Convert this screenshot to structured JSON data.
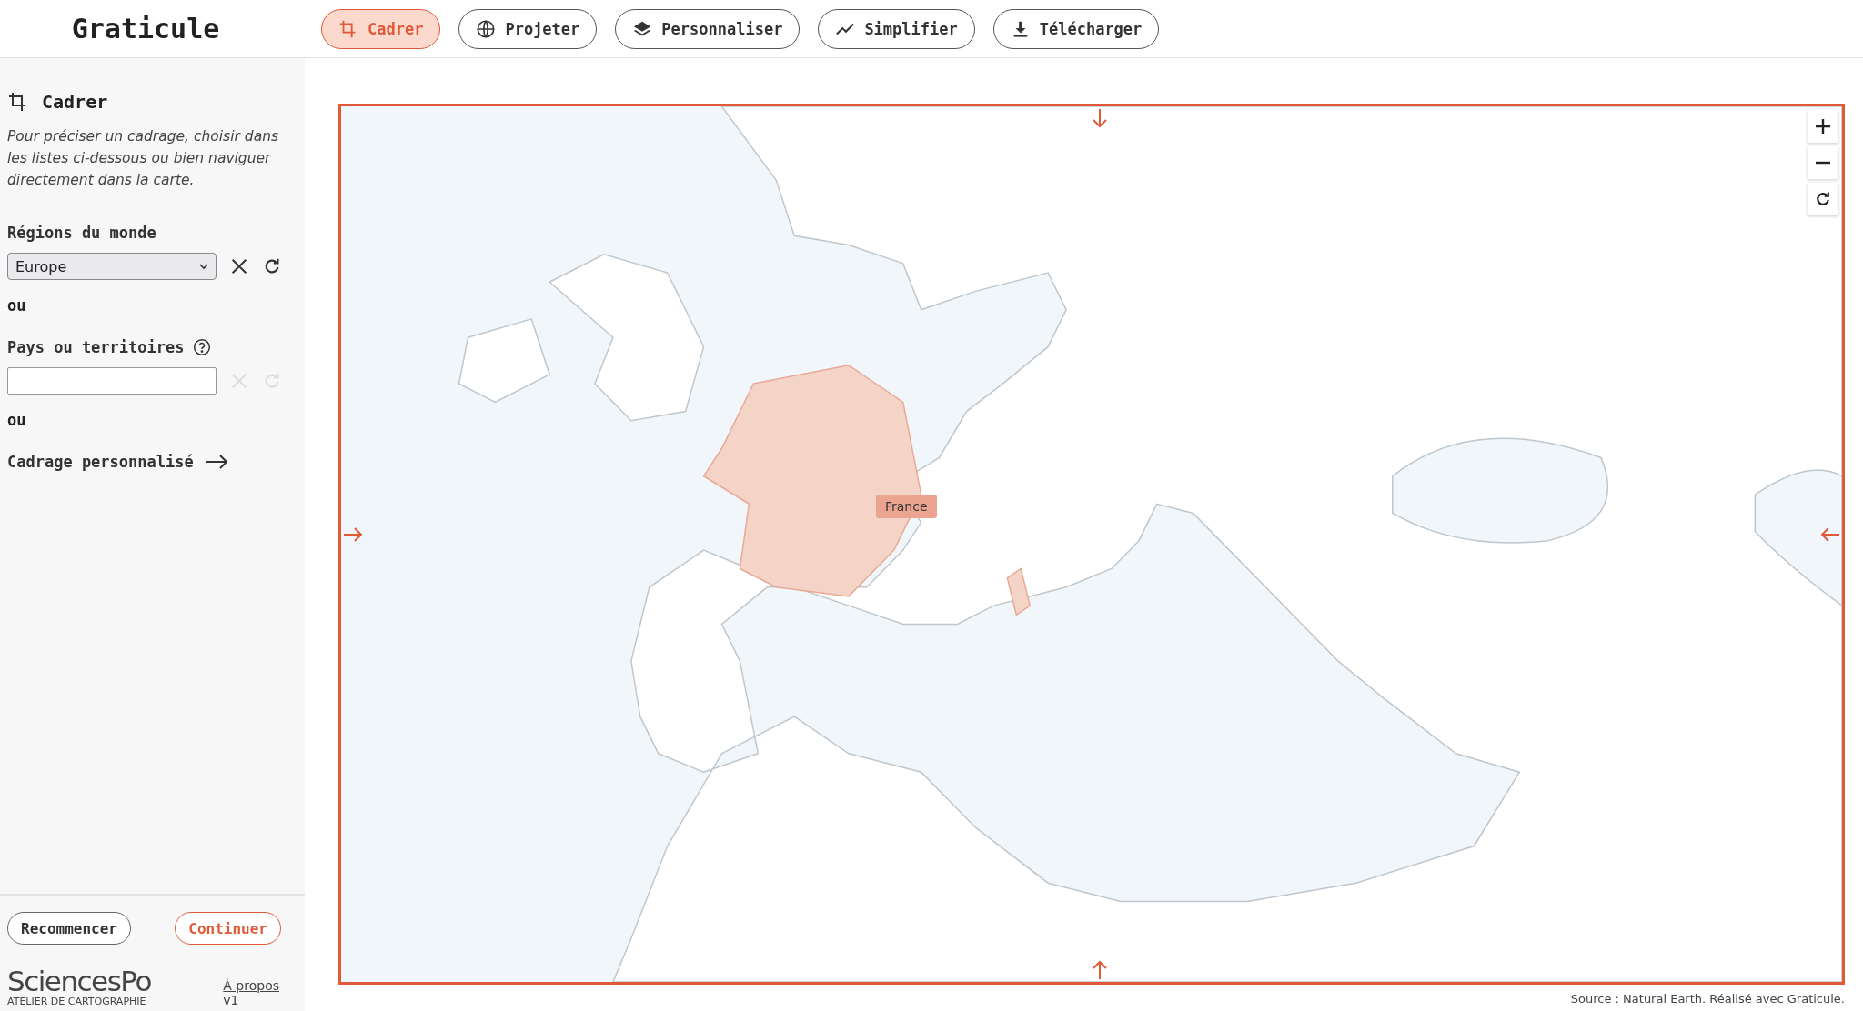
{
  "app": {
    "title": "Graticule"
  },
  "tabs": [
    {
      "label": "Cadrer",
      "kind": "crop",
      "selected": true
    },
    {
      "label": "Projeter",
      "kind": "globe",
      "selected": false
    },
    {
      "label": "Personnaliser",
      "kind": "layers",
      "selected": false
    },
    {
      "label": "Simplifier",
      "kind": "trend",
      "selected": false
    },
    {
      "label": "Télécharger",
      "kind": "download",
      "selected": false
    }
  ],
  "panel": {
    "title": "Cadrer",
    "intro": "Pour préciser un cadrage, choisir dans les listes ci-dessous ou bien naviguer directement dans la carte.",
    "regions": {
      "label": "Régions du monde",
      "value": "Europe",
      "actions_disabled": false
    },
    "separator_1": "ou",
    "countries": {
      "label": "Pays ou territoires",
      "actions_disabled": true
    },
    "separator_2": "ou",
    "custom_link": "Cadrage personnalisé"
  },
  "footer_buttons": [
    {
      "label": "Recommencer",
      "primary": false
    },
    {
      "label": "Continuer",
      "primary": true
    }
  ],
  "logo": {
    "name": "SciencesPo",
    "subtitle": "ATELIER DE CARTOGRAPHIE"
  },
  "about_link": "À propos",
  "version": "v1",
  "map": {
    "highlighted_label": "France",
    "source": "Source : Natural Earth. Réalisé avec Graticule."
  }
}
